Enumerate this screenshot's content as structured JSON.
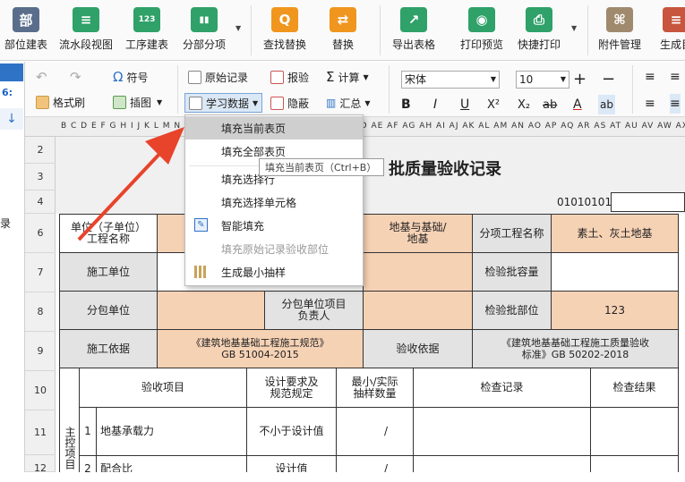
{
  "ribbon": {
    "items": [
      {
        "label": "部位建表",
        "color": "#5a6e8c",
        "glyph": "部"
      },
      {
        "label": "流水段视图",
        "color": "#2fa169",
        "glyph": "≡"
      },
      {
        "label": "工序建表",
        "color": "#2fa169",
        "glyph": "123"
      },
      {
        "label": "分部分项",
        "color": "#2fa169",
        "glyph": "▮▮"
      },
      {
        "label": "查找替换",
        "color": "#f0961e",
        "glyph": "Q"
      },
      {
        "label": "替换",
        "color": "#f0961e",
        "glyph": "⇄"
      },
      {
        "label": "导出表格",
        "color": "#2fa169",
        "glyph": "↗"
      },
      {
        "label": "打印预览",
        "color": "#2fa169",
        "glyph": "◉"
      },
      {
        "label": "快捷打印",
        "color": "#2fa169",
        "glyph": "⎙"
      },
      {
        "label": "附件管理",
        "color": "#a08a6e",
        "glyph": "⌘"
      },
      {
        "label": "生成目",
        "color": "#c8553d",
        "glyph": "≡"
      }
    ]
  },
  "leftstrip": {
    "num": "6:",
    "vertical": "录"
  },
  "toolbar": {
    "format_brush": "格式刷",
    "symbol": "符号",
    "insert_image": "插图",
    "original_record": "原始记录",
    "learn_data": "学习数据",
    "report": "报验",
    "hide": "隐蔽",
    "calc": "计算",
    "summary": "汇总",
    "font": "宋体",
    "size": "10",
    "bold": "B",
    "italic": "I",
    "underline": "U",
    "superscript": "X²",
    "subscript": "X₂",
    "strike": "ab",
    "font_color": "A",
    "wrap": "ab"
  },
  "colhdr": "B C D E F G H I J K L M N O P Q R S T U V W X Y Z AA AB AC AD AE AF AG AH AI AJ AK AL AM AN AO AP AQ AR AS AT AU AV AW AX AY AZ BA BB BC BD BE BF BG BH BI BJ BK BL",
  "rows": [
    "2",
    "3",
    "4",
    "6",
    "7",
    "8",
    "9",
    "10",
    "11",
    "12"
  ],
  "sheet": {
    "title": "批质量验收记录",
    "code": "01010101",
    "unit_name_label": "单位（子单位）\n工程名称",
    "fenbu_value": "地基与基础/\n地基",
    "fenxiang_label": "分项工程名称",
    "fenxiang_value": "素土、灰土地基",
    "construct_unit": "施工单位",
    "capacity_label": "检验批容量",
    "sub_unit": "分包单位",
    "sub_pm": "分包单位项目\n负责人",
    "part_label": "检验批部位",
    "part_value": "123",
    "basis_label": "施工依据",
    "basis_value": "《建筑地基基础工程施工规范》\nGB 51004-2015",
    "accept_basis_label": "验收依据",
    "accept_basis_value": "《建筑地基基础工程施工质量验收\n标准》GB 50202-2018",
    "item_label": "验收项目",
    "req_label": "设计要求及\n规范规定",
    "min_label": "最小/实际\n抽样数量",
    "check_record": "检查记录",
    "check_result": "检查结果",
    "main_items": "主控项目",
    "row1_no": "1",
    "row1_name": "地基承载力",
    "row1_req": "不小于设计值",
    "slash": "/",
    "row2_no": "2",
    "row2_name": "配合比",
    "row2_req": "设计值"
  },
  "menu": {
    "items": [
      {
        "label": "填充当前表页",
        "state": "highlight"
      },
      {
        "label": "填充全部表页",
        "state": "normal"
      },
      {
        "label": "填充选择行",
        "state": "normal"
      },
      {
        "label": "填充选择单元格",
        "state": "normal"
      },
      {
        "label": "智能填充",
        "state": "normal"
      },
      {
        "label": "填充原始记录验收部位",
        "state": "disabled"
      },
      {
        "label": "生成最小抽样",
        "state": "normal"
      }
    ]
  },
  "tooltip": "填充当前表页（Ctrl+B）",
  "colors": {
    "pink": "#f6d2b5",
    "arrow": "#e8432b"
  }
}
